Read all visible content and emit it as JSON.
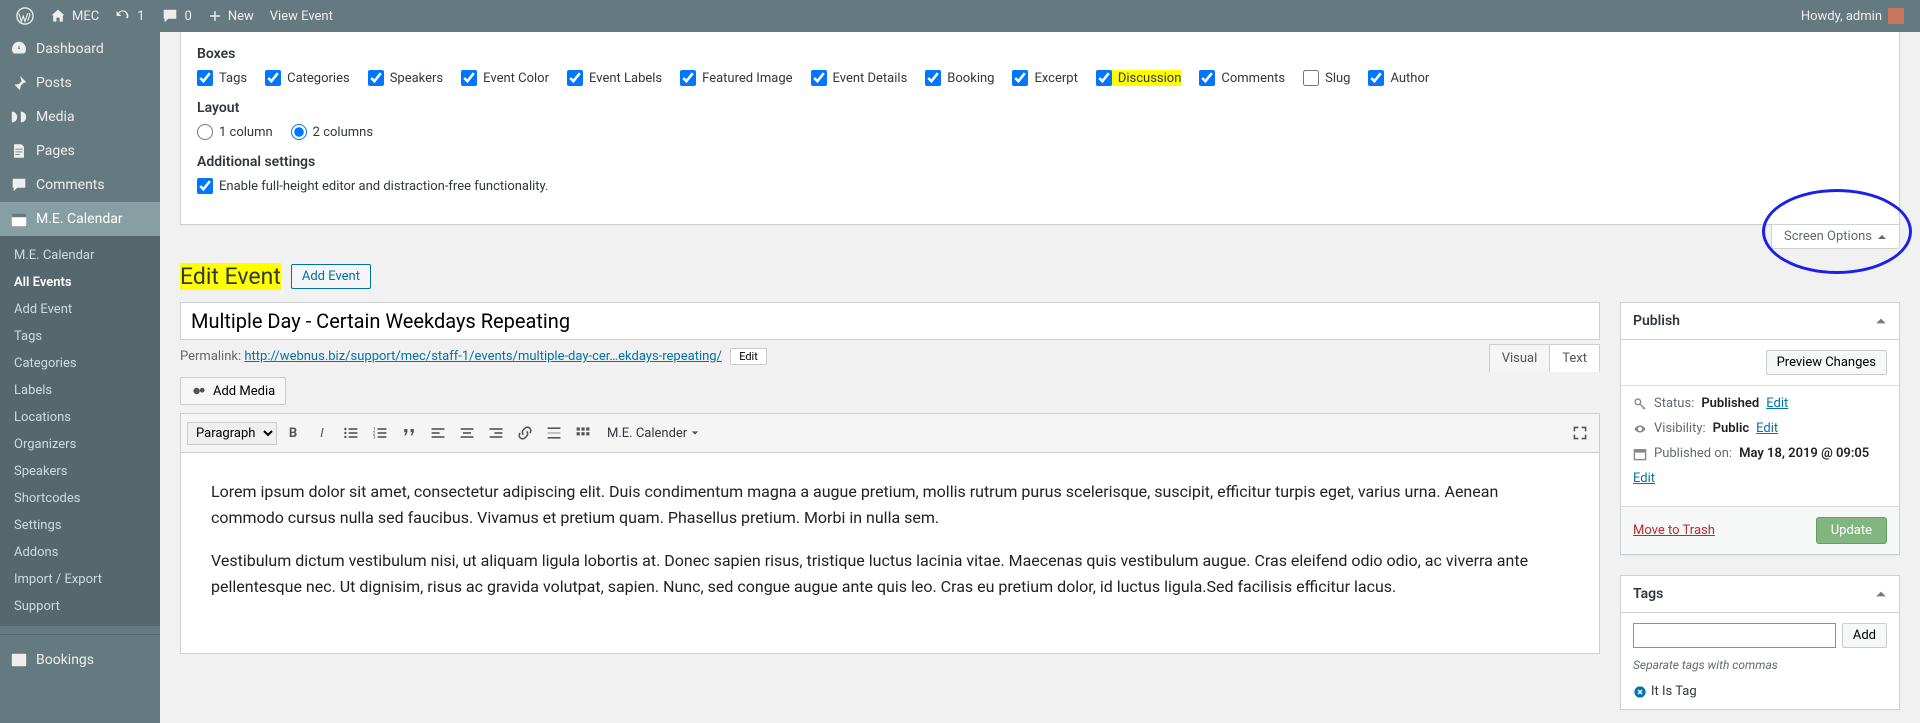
{
  "adminbar": {
    "site_name": "MEC",
    "updates": "1",
    "comments": "0",
    "new_label": "New",
    "view_label": "View Event",
    "howdy": "Howdy, admin"
  },
  "sidebar": {
    "dashboard": "Dashboard",
    "posts": "Posts",
    "media": "Media",
    "pages": "Pages",
    "comments": "Comments",
    "mec": "M.E. Calendar",
    "submenu": {
      "mec_calendar": "M.E. Calendar",
      "all_events": "All Events",
      "add_event": "Add Event",
      "tags": "Tags",
      "categories": "Categories",
      "labels": "Labels",
      "locations": "Locations",
      "organizers": "Organizers",
      "speakers": "Speakers",
      "shortcodes": "Shortcodes",
      "settings": "Settings",
      "addons": "Addons",
      "import_export": "Import / Export",
      "support": "Support"
    },
    "bookings": "Bookings"
  },
  "screen_options": {
    "tab_label": "Screen Options",
    "boxes_label": "Boxes",
    "boxes": {
      "tags": "Tags",
      "categories": "Categories",
      "speakers": "Speakers",
      "event_color": "Event Color",
      "event_labels": "Event Labels",
      "featured_image": "Featured Image",
      "event_details": "Event Details",
      "booking": "Booking",
      "excerpt": "Excerpt",
      "discussion": "Discussion",
      "comments": "Comments",
      "slug": "Slug",
      "author": "Author"
    },
    "layout_label": "Layout",
    "col1": "1 column",
    "col2": "2 columns",
    "additional_label": "Additional settings",
    "fullheight": "Enable full-height editor and distraction-free functionality."
  },
  "page": {
    "title": "Edit Event",
    "add_btn": "Add Event"
  },
  "post": {
    "title": "Multiple Day - Certain Weekdays Repeating",
    "permalink_label": "Permalink:",
    "permalink_url_pre": "http://webnus.biz/support/mec/staff-1/events/",
    "permalink_slug": "multiple-day-cer…ekdays-repeating/",
    "edit_btn": "Edit"
  },
  "editor": {
    "add_media": "Add Media",
    "tab_visual": "Visual",
    "tab_text": "Text",
    "format_sel": "Paragraph",
    "mec_menu": "M.E. Calender",
    "para1": "Lorem ipsum dolor sit amet, consectetur adipiscing elit. Duis condimentum magna a augue pretium, mollis rutrum purus scelerisque, suscipit, efficitur turpis eget, varius urna. Aenean commodo cursus nulla sed faucibus. Vivamus et pretium quam. Phasellus pretium. Morbi in nulla sem.",
    "para2": "Vestibulum dictum vestibulum nisi, ut aliquam ligula lobortis at. Donec sapien risus, tristique luctus lacinia vitae. Maecenas quis vestibulum augue. Cras eleifend odio odio, ac viverra ante pellentesque nec. Ut dignisim, risus ac gravida volutpat, sapien. Nunc, sed congue augue ante quis leo. Cras eu pretium dolor, id luctus ligula.Sed facilisis efficitur lacus."
  },
  "publish": {
    "header": "Publish",
    "preview": "Preview Changes",
    "status_label": "Status:",
    "status_value": "Published",
    "visibility_label": "Visibility:",
    "visibility_value": "Public",
    "published_label": "Published on:",
    "published_value": "May 18, 2019 @ 09:05",
    "edit": "Edit",
    "trash": "Move to Trash",
    "update": "Update"
  },
  "tags": {
    "header": "Tags",
    "add": "Add",
    "help": "Separate tags with commas",
    "item1": "It Is Tag"
  }
}
